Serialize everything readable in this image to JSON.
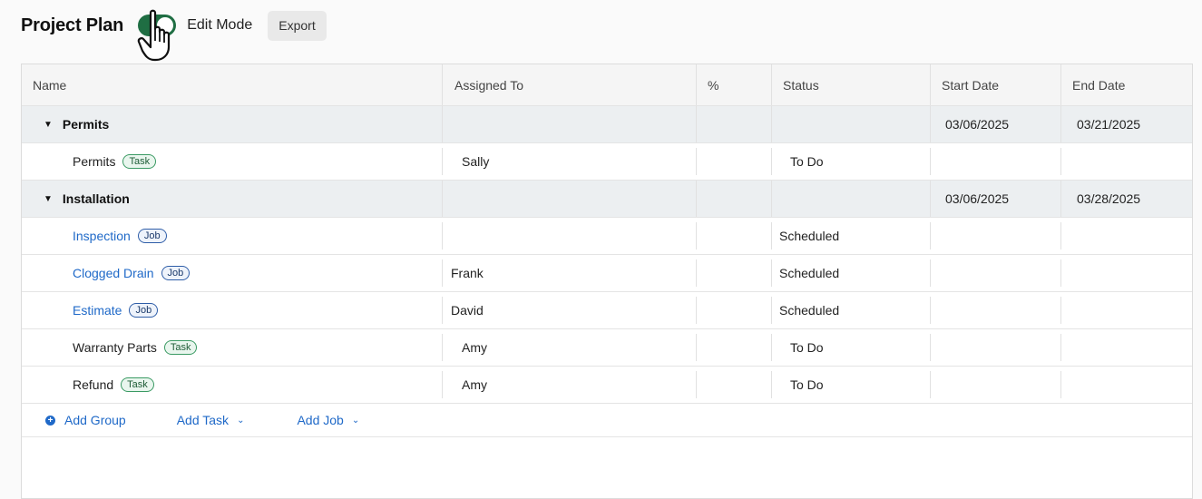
{
  "header": {
    "title": "Project Plan",
    "edit_mode_label": "Edit Mode",
    "edit_mode_on": true,
    "export_label": "Export"
  },
  "columns": {
    "name": "Name",
    "assigned": "Assigned To",
    "pct": "%",
    "status": "Status",
    "start": "Start Date",
    "end": "End Date"
  },
  "groups": [
    {
      "name": "Permits",
      "start": "03/06/2025",
      "end": "03/21/2025",
      "items": [
        {
          "name": "Permits",
          "type": "Task",
          "assigned": "Sally",
          "status": "To Do"
        }
      ]
    },
    {
      "name": "Installation",
      "start": "03/06/2025",
      "end": "03/28/2025",
      "items": [
        {
          "name": "Inspection",
          "type": "Job",
          "assigned": "",
          "status": "Scheduled"
        },
        {
          "name": "Clogged Drain",
          "type": "Job",
          "assigned": "Frank",
          "status": "Scheduled"
        },
        {
          "name": "Estimate",
          "type": "Job",
          "assigned": "David",
          "status": "Scheduled"
        },
        {
          "name": "Warranty Parts",
          "type": "Task",
          "assigned": "Amy",
          "status": "To Do"
        },
        {
          "name": "Refund",
          "type": "Task",
          "assigned": "Amy",
          "status": "To Do"
        }
      ]
    }
  ],
  "actions": {
    "add_group": "Add Group",
    "add_task": "Add Task",
    "add_job": "Add Job"
  },
  "colors": {
    "accent": "#1f69c8",
    "toggle_on": "#1f6e43"
  }
}
